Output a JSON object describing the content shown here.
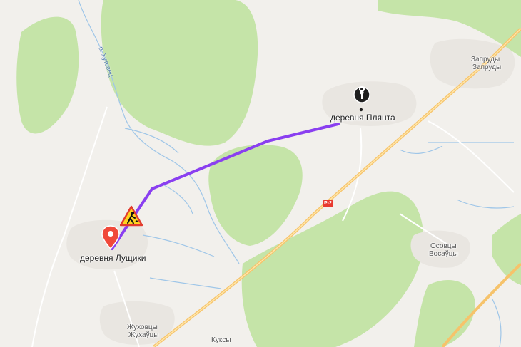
{
  "map": {
    "places": {
      "plyanta": "деревня Плянта",
      "lushchiki": "деревня Лущики",
      "zapruda_ru": "Запруды",
      "zapruda_by": "Запруды",
      "osovtsy_ru": "Осовцы",
      "osovtsy_by": "Восаўцы",
      "zhukhovtsy_ru": "Жуховцы",
      "zhukhovtsy_by": "Жухаўцы",
      "kuksy": "Куксы"
    },
    "river_label": "р. Хутовец",
    "road_badge": "Р-2",
    "route_color": "#8a3ff0",
    "start_pin_color": "#f0493a",
    "end_pin_color": "#1f1f1f",
    "icons": [
      "road-works-icon",
      "start-pin-icon",
      "end-pin-icon"
    ]
  }
}
